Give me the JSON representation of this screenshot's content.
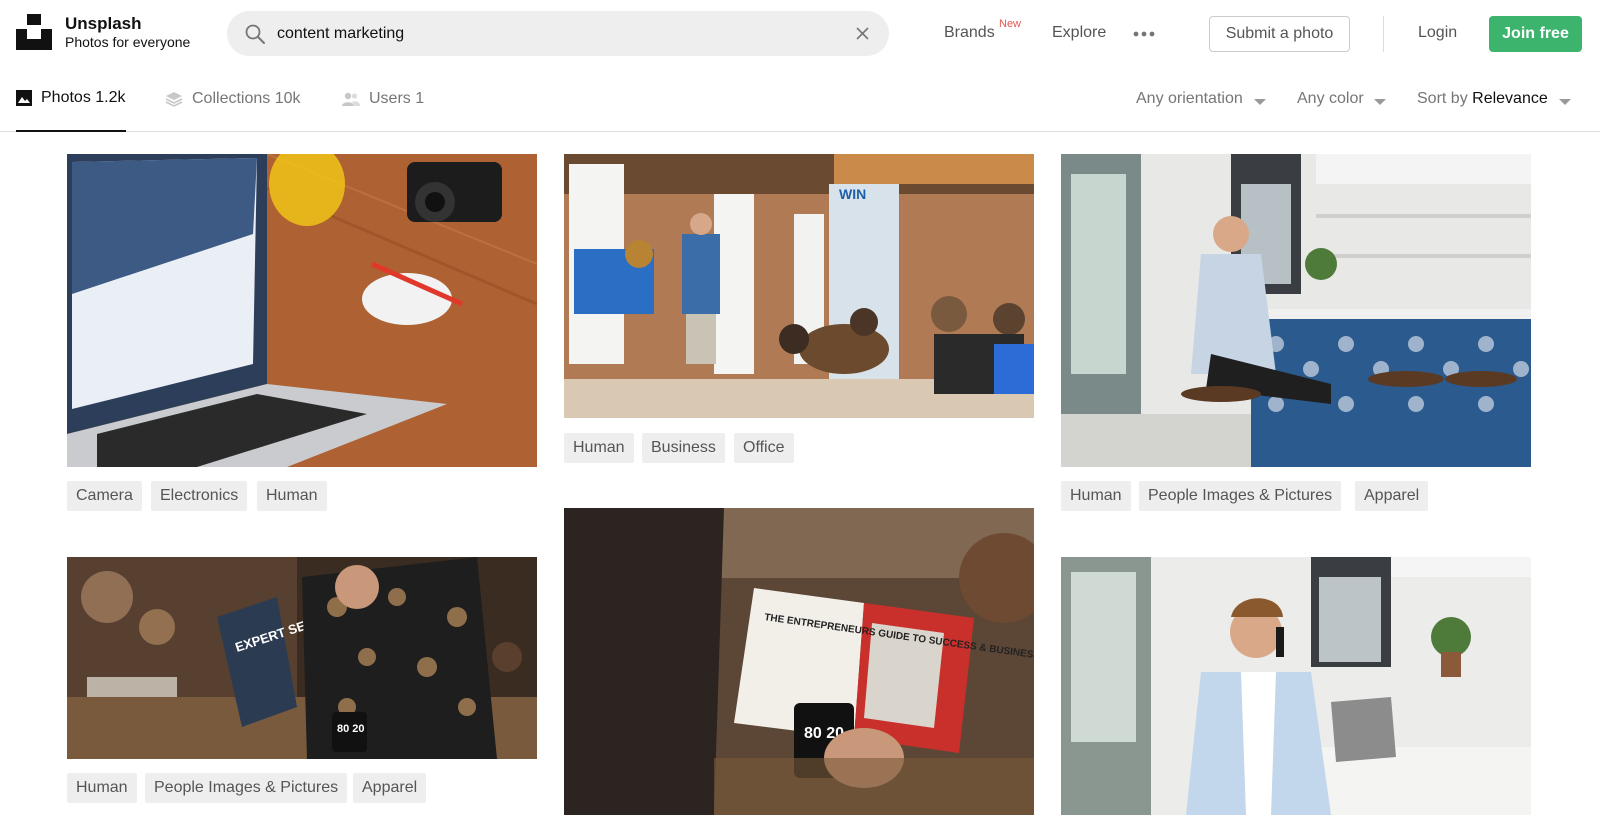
{
  "header": {
    "brand_name": "Unsplash",
    "brand_tagline": "Photos for everyone",
    "search_value": "content marketing",
    "nav": {
      "brands": "Brands",
      "brands_badge": "New",
      "explore": "Explore"
    },
    "submit_label": "Submit a photo",
    "login_label": "Login",
    "join_label": "Join free"
  },
  "tabs": [
    {
      "label": "Photos 1.2k",
      "icon": "image-icon"
    },
    {
      "label": "Collections 10k",
      "icon": "collections-icon"
    },
    {
      "label": "Users 1",
      "icon": "users-icon"
    }
  ],
  "filters": {
    "orientation": "Any orientation",
    "color": "Any color",
    "sort_prefix": "Sort by",
    "sort_value": "Relevance"
  },
  "photos": [
    {
      "tags": [
        "Camera",
        "Electronics",
        "Human"
      ]
    },
    {
      "tags": [
        "Human",
        "Business",
        "Office"
      ]
    },
    {
      "tags": [
        "Human",
        "People Images & Pictures",
        "Apparel"
      ]
    },
    {
      "tags": [
        "Human",
        "People Images & Pictures",
        "Apparel"
      ]
    },
    {
      "tags": []
    },
    {
      "tags": []
    }
  ],
  "colors": {
    "accent_green": "#3cb46e",
    "badge_red": "#e25950"
  },
  "photo_text": {
    "win_sign": "WIN",
    "book_cover": "EXPERT SECRETS",
    "magazine_headline": "THE ENTREPRENEURS GUIDE TO SUCCESS & BUSINESS GROWTH",
    "mug_print": "80 20"
  }
}
